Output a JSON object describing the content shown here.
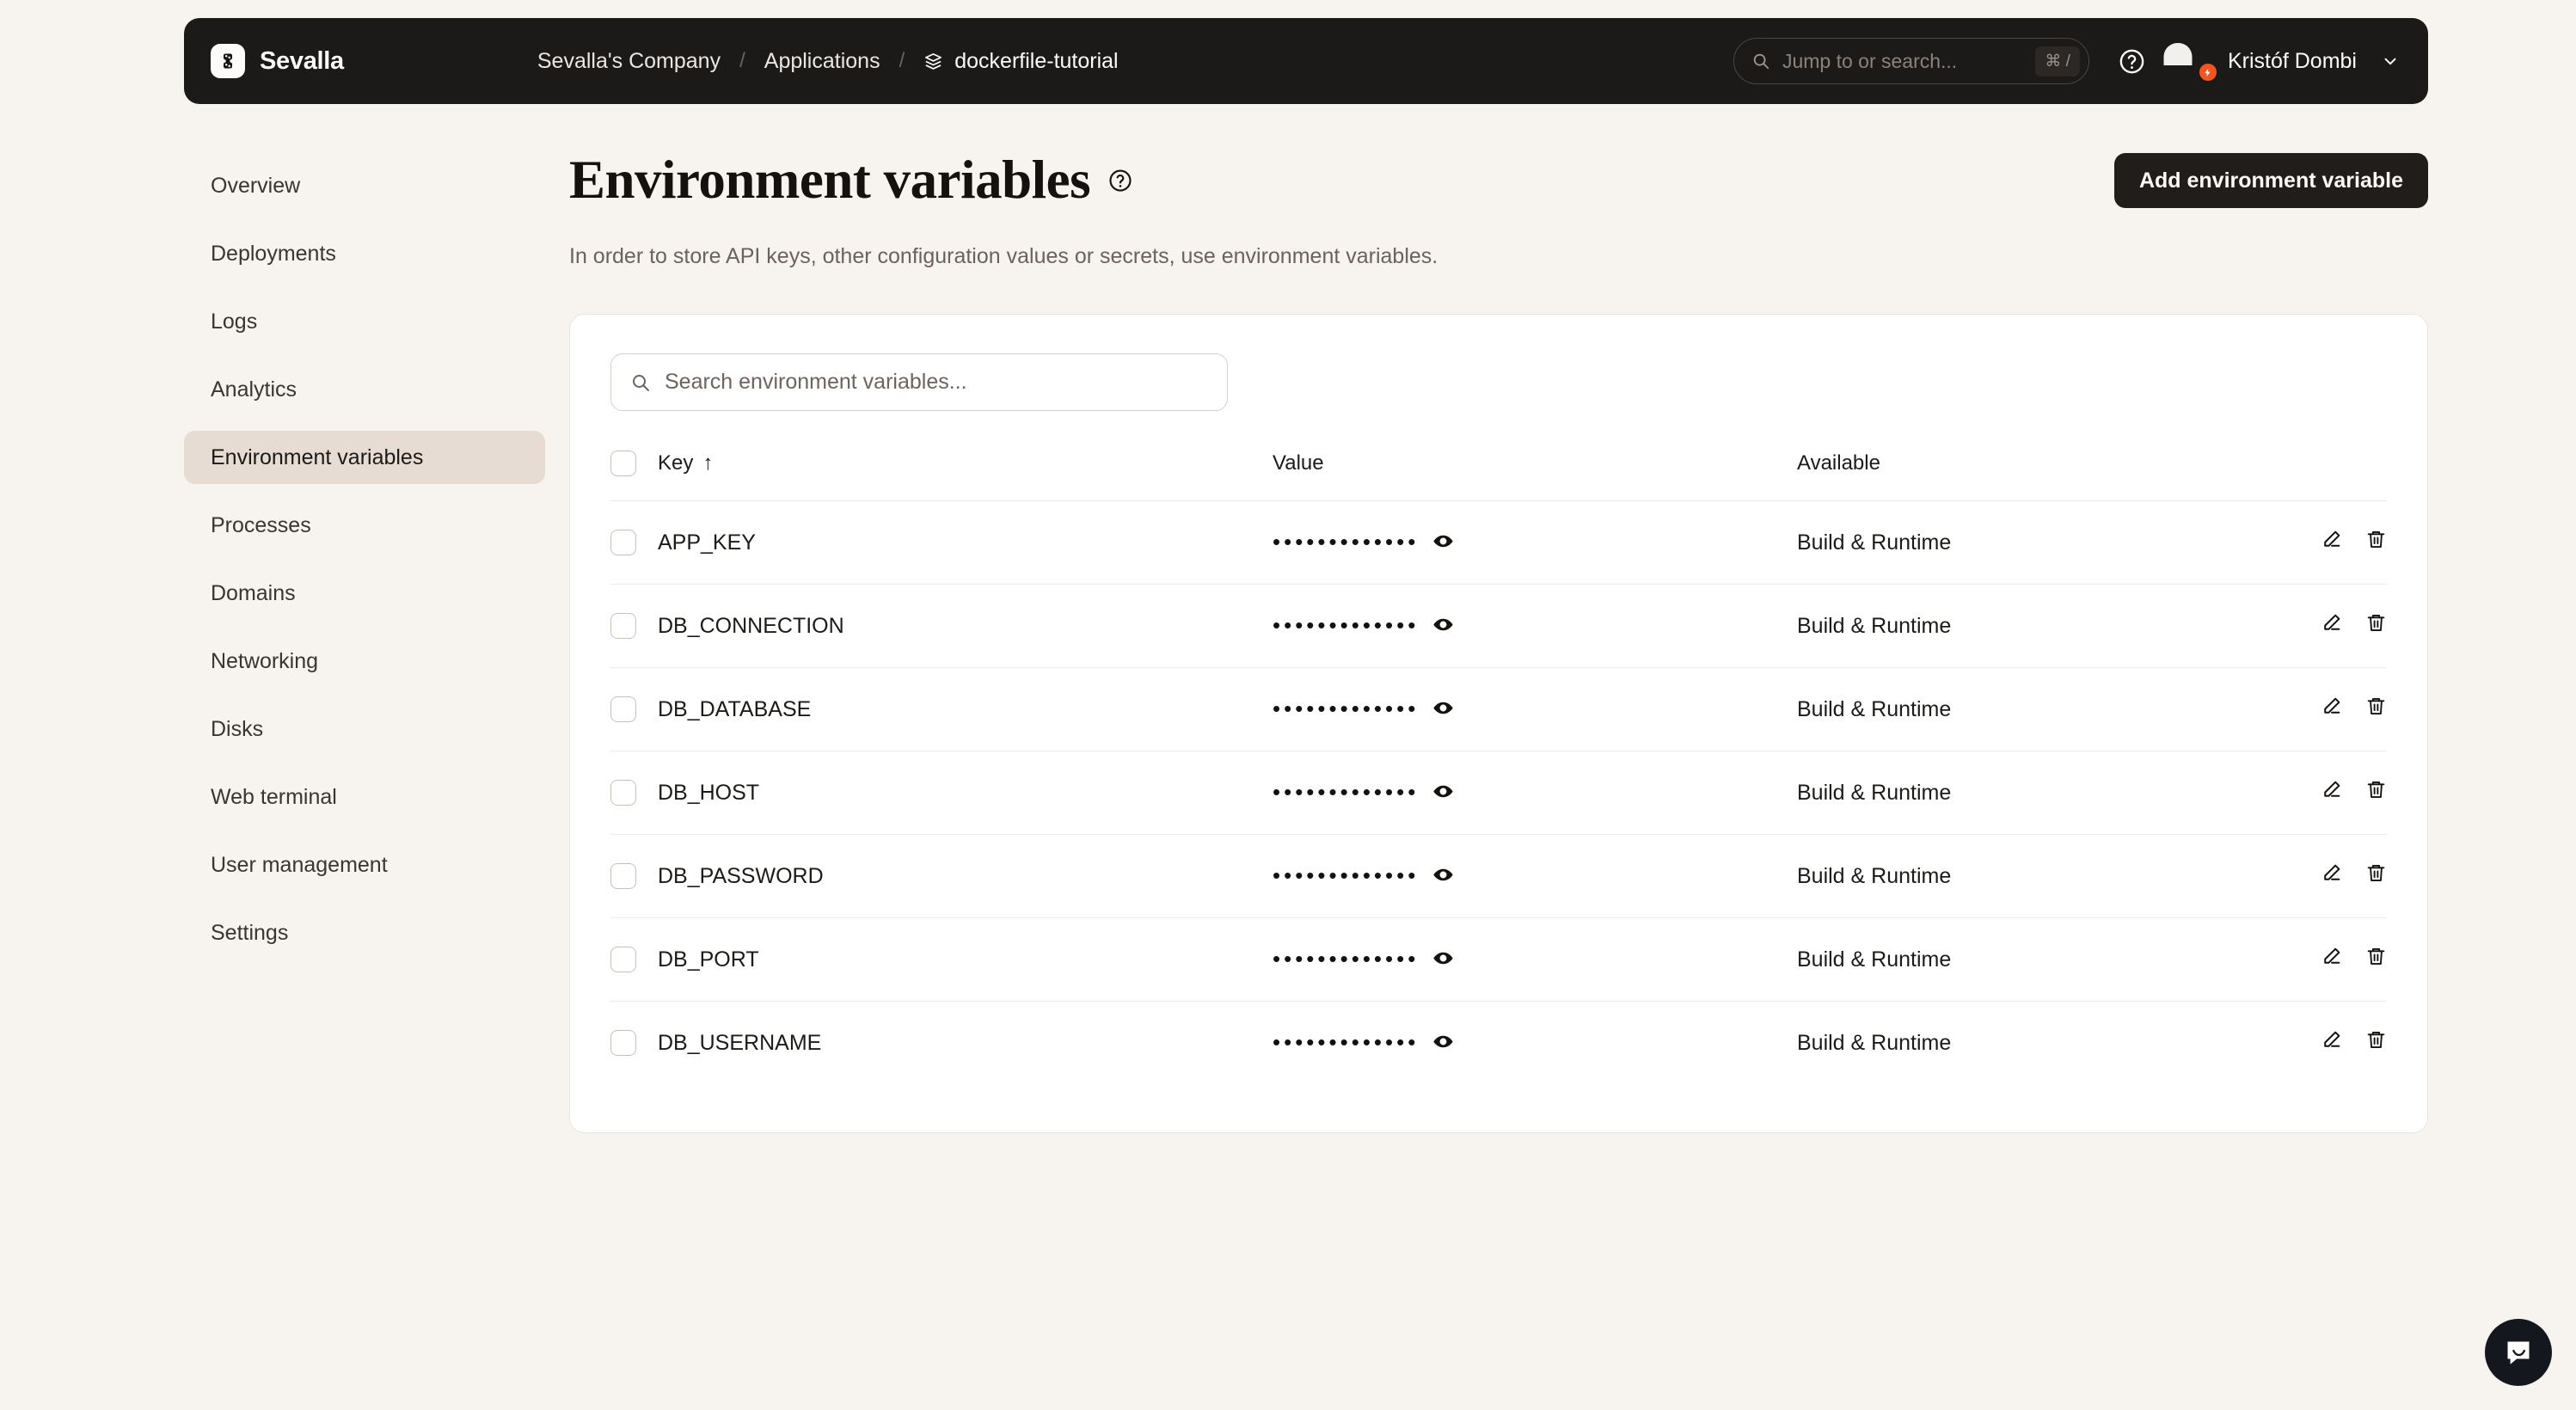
{
  "brand": {
    "name": "Sevalla",
    "logo_icon": "sevalla-logo-icon"
  },
  "breadcrumb": {
    "organization": "Sevalla's Company",
    "section": "Applications",
    "app": "dockerfile-tutorial",
    "separator": "/",
    "app_icon": "layers-icon"
  },
  "topnav": {
    "search_placeholder": "Jump to or search...",
    "search_shortcut": "⌘ /",
    "help_icon": "question-circle-icon",
    "user_name": "Kristóf Dombi",
    "avatar_badge_icon": "lightning-bolt-icon",
    "chevron_icon": "chevron-down-icon"
  },
  "sidebar": {
    "items": [
      {
        "label": "Overview",
        "active": false
      },
      {
        "label": "Deployments",
        "active": false
      },
      {
        "label": "Logs",
        "active": false
      },
      {
        "label": "Analytics",
        "active": false
      },
      {
        "label": "Environment variables",
        "active": true
      },
      {
        "label": "Processes",
        "active": false
      },
      {
        "label": "Domains",
        "active": false
      },
      {
        "label": "Networking",
        "active": false
      },
      {
        "label": "Disks",
        "active": false
      },
      {
        "label": "Web terminal",
        "active": false
      },
      {
        "label": "User management",
        "active": false
      },
      {
        "label": "Settings",
        "active": false
      }
    ]
  },
  "page": {
    "title": "Environment variables",
    "title_help_icon": "question-circle-icon",
    "subtitle": "In order to store API keys, other configuration values or secrets, use environment variables.",
    "add_button": "Add environment variable"
  },
  "table": {
    "search_placeholder": "Search environment variables...",
    "search_icon": "search-icon",
    "columns": {
      "key": "Key",
      "key_sort_icon": "↑",
      "value": "Value",
      "available": "Available"
    },
    "masked_value": "•••••••••••••",
    "reveal_icon": "eye-icon",
    "edit_icon": "pencil-icon",
    "delete_icon": "trash-icon",
    "rows": [
      {
        "key": "APP_KEY",
        "available": "Build & Runtime"
      },
      {
        "key": "DB_CONNECTION",
        "available": "Build & Runtime"
      },
      {
        "key": "DB_DATABASE",
        "available": "Build & Runtime"
      },
      {
        "key": "DB_HOST",
        "available": "Build & Runtime"
      },
      {
        "key": "DB_PASSWORD",
        "available": "Build & Runtime"
      },
      {
        "key": "DB_PORT",
        "available": "Build & Runtime"
      },
      {
        "key": "DB_USERNAME",
        "available": "Build & Runtime"
      }
    ]
  },
  "chat": {
    "icon": "chat-bubble-icon"
  },
  "colors": {
    "page_background": "#f7f3ef",
    "topbar": "#1c1a19",
    "card": "#ffffff",
    "sidebar_active": "#e6dcd4",
    "primary_button": "#201d1b",
    "badge_orange": "#f4541f"
  }
}
